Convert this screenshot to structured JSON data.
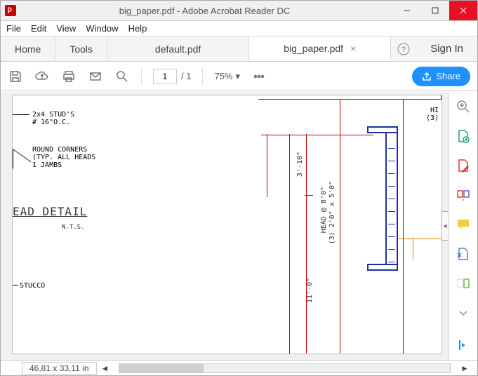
{
  "window": {
    "title": "big_paper.pdf - Adobe Acrobat Reader DC"
  },
  "menu": [
    "File",
    "Edit",
    "View",
    "Window",
    "Help"
  ],
  "tabs": {
    "home": "Home",
    "tools": "Tools",
    "doc1": "default.pdf",
    "doc2": "big_paper.pdf",
    "signin": "Sign In"
  },
  "toolbar": {
    "page_current": "1",
    "page_total": "/ 1",
    "zoom": "75%",
    "share": "Share"
  },
  "status": {
    "dimensions": "46,81 x 33,11 in"
  },
  "drawing": {
    "note_studs": "2x4 STUD'S\n# 16\"O.C.",
    "note_corners": "ROUND CORNERS\n(TYP. ALL HEADS\n1 JAMBS",
    "head_detail": "EAD DETAIL",
    "nts": "N.T.S.",
    "stucco": "STUCCO",
    "dim1": "3'-10\"",
    "dim2": "HEAD @ 8'0\"",
    "dim3": "(3) 2'0\" x 5'0\"",
    "dim4": "11'-0\"",
    "top_h": "HI",
    "top_3": "(3)"
  }
}
